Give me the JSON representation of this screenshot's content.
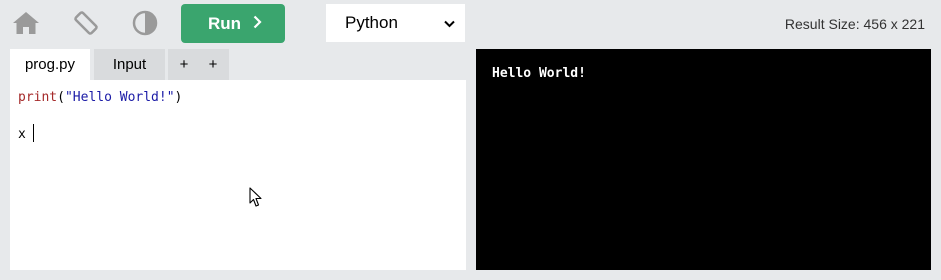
{
  "toolbar": {
    "home_icon": "home-icon",
    "rotate_icon": "rotate-device-icon",
    "contrast_icon": "contrast-icon",
    "run_label": "Run",
    "language": "Python",
    "result_size": "Result Size: 456 x 221"
  },
  "editor": {
    "tabs": [
      {
        "label": "prog.py",
        "active": true
      },
      {
        "label": "Input",
        "active": false
      },
      {
        "label": "+",
        "active": false
      },
      {
        "label": "+",
        "active": false
      }
    ],
    "code": {
      "line1_fn": "print",
      "line1_open": "(",
      "line1_str": "\"Hello World!\"",
      "line1_close": ")",
      "line3": "x"
    }
  },
  "result": {
    "output": "Hello World!"
  },
  "colors": {
    "run_button": "#3aa56e",
    "background": "#e7e9eb",
    "result_bg": "#000000",
    "keyword": "#a52a2a",
    "string": "#1a1aa6"
  }
}
